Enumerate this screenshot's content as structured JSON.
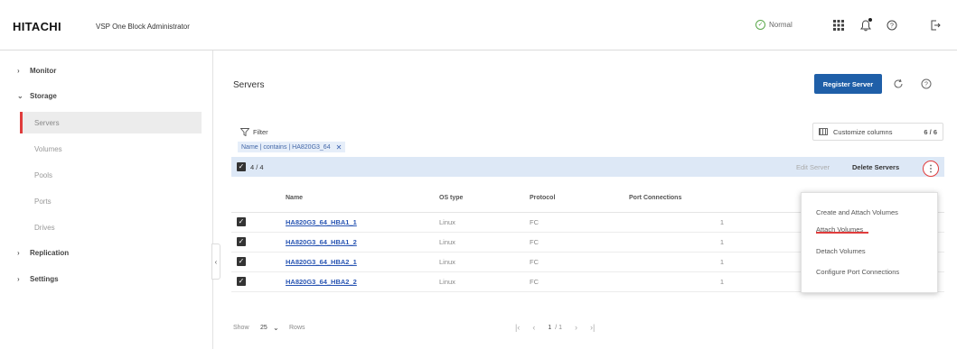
{
  "header": {
    "logo": "HITACHI",
    "app_name": "VSP One Block Administrator",
    "status": "Normal",
    "icons": [
      "status-ok-icon",
      "apps-grid-icon",
      "notifications-icon",
      "help-icon",
      "logout-icon"
    ]
  },
  "sidebar": {
    "items": [
      {
        "label": "Monitor",
        "expanded": false
      },
      {
        "label": "Storage",
        "expanded": true
      },
      {
        "label": "Servers",
        "active": true
      },
      {
        "label": "Volumes"
      },
      {
        "label": "Pools"
      },
      {
        "label": "Ports"
      },
      {
        "label": "Drives"
      },
      {
        "label": "Replication",
        "expanded": false
      },
      {
        "label": "Settings",
        "expanded": false
      }
    ]
  },
  "main": {
    "title": "Servers",
    "register_button": "Register Server",
    "filter_label": "Filter",
    "filter_chip": "Name | contains | HA820G3_64",
    "customize_label": "Customize columns",
    "customize_count": "6 / 6",
    "selection": "4 / 4",
    "edit_label": "Edit Server",
    "delete_label": "Delete Servers"
  },
  "table": {
    "columns": [
      "Name",
      "OS type",
      "Protocol",
      "Port Connections"
    ],
    "rows": [
      {
        "name": "HA820G3_64_HBA1_1",
        "os": "Linux",
        "protocol": "FC",
        "ports": "1"
      },
      {
        "name": "HA820G3_64_HBA1_2",
        "os": "Linux",
        "protocol": "FC",
        "ports": "1"
      },
      {
        "name": "HA820G3_64_HBA2_1",
        "os": "Linux",
        "protocol": "FC",
        "ports": "1"
      },
      {
        "name": "HA820G3_64_HBA2_2",
        "os": "Linux",
        "protocol": "FC",
        "ports": "1"
      }
    ]
  },
  "footer": {
    "show_label": "Show",
    "per_page": "25",
    "rows_label": "Rows",
    "page": "1",
    "page_total": "/ 1"
  },
  "menu": {
    "items": [
      "Create and Attach Volumes",
      "Attach Volumes",
      "Detach Volumes",
      "Configure Port Connections"
    ],
    "highlighted": "Attach Volumes"
  },
  "colors": {
    "primary": "#1f5fa8",
    "accent_red": "#e03c3c",
    "selection_bar": "#dde8f6",
    "status_green": "#5ba84c"
  }
}
